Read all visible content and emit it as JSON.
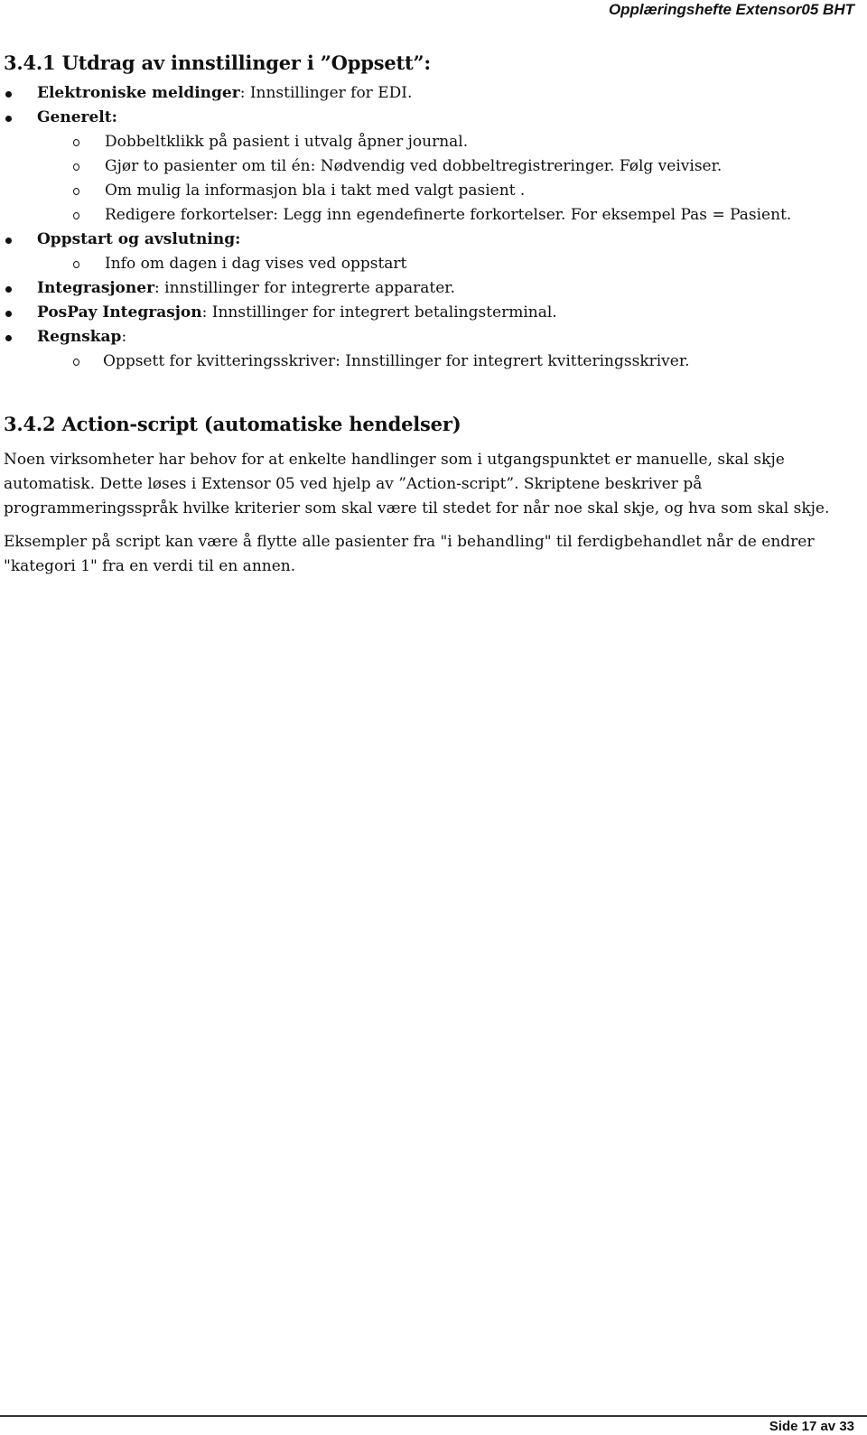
{
  "header": {
    "title": "Opplæringshefte Extensor05 BHT"
  },
  "section1": {
    "heading": "3.4.1 Utdrag av innstillinger i ”Oppsett”:",
    "items": [
      {
        "label": "Elektroniske meldinger",
        "text": ": Innstillinger for EDI.",
        "sub": []
      },
      {
        "label": "Generelt:",
        "text": "",
        "sub": [
          "Dobbeltklikk på pasient i utvalg åpner journal.",
          "Gjør to pasienter om til én: Nødvendig ved dobbeltregistreringer. Følg veiviser.",
          "Om mulig la informasjon bla i takt med valgt pasient .",
          "Redigere forkortelser: Legg inn egendefinerte forkortelser. For eksempel Pas = Pasient."
        ]
      },
      {
        "label": "Oppstart og avslutning:",
        "text": "",
        "sub": [
          "Info om dagen i dag vises ved oppstart"
        ]
      },
      {
        "label": "Integrasjoner",
        "text": ": innstillinger for integrerte apparater.",
        "sub": []
      },
      {
        "label": "PosPay Integrasjon",
        "text": ": Innstillinger for integrert betalingsterminal.",
        "sub": []
      },
      {
        "label": "Regnskap",
        "text": ":",
        "sub": [
          "Oppsett for kvitteringsskriver: Innstillinger for integrert kvitteringsskriver."
        ]
      }
    ]
  },
  "section2": {
    "heading": "3.4.2 Action-script (automatiske hendelser)",
    "paragraphs": [
      "Noen virksomheter har behov for at enkelte handlinger som i utgangspunktet er manuelle, skal skje automatisk. Dette løses i Extensor 05 ved hjelp av ”Action-script”. Skriptene beskriver på programmeringsspråk hvilke kriterier som skal være til stedet for når noe skal skje, og hva som skal skje.",
      "Eksempler på script kan være å flytte alle pasienter fra \"i behandling\" til ferdigbehandlet når de endrer \"kategori 1\" fra en verdi til en annen."
    ]
  },
  "footer": {
    "page_label": "Side 17 av 33"
  }
}
